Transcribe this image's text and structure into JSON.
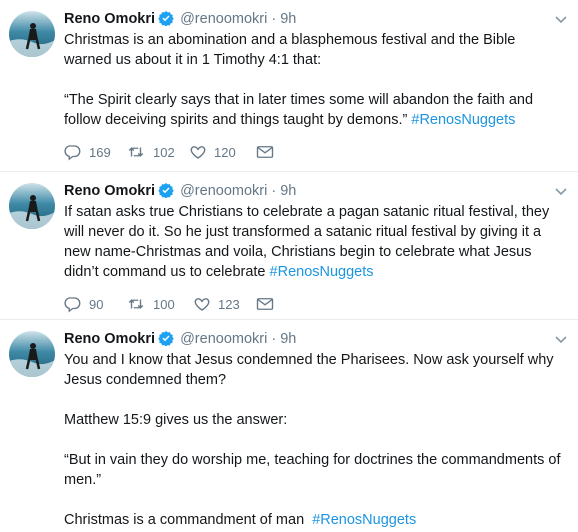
{
  "colors": {
    "text": "#14171a",
    "secondary": "#657786",
    "hashtag": "#1b95e0",
    "verified": "#1da1f2",
    "divider": "#e6ecf0"
  },
  "icons": {
    "reply": "reply-icon",
    "retweet": "retweet-icon",
    "like": "like-icon",
    "message": "message-icon",
    "verified": "verified-badge-icon",
    "menu": "chevron-down-icon"
  },
  "tweets": [
    {
      "name": "Reno Omokri",
      "handle": "@renoomokri",
      "dot": "·",
      "time": "9h",
      "para1": "Christmas is an abomination and a blasphemous festival and the Bible warned us about it in 1 Timothy 4:1 that:",
      "para2": "“The Spirit clearly says that in later times some will abandon the faith and follow deceiving spirits and things taught by demons.”",
      "hashtag": "#RenosNuggets",
      "replies": "169",
      "retweets": "102",
      "likes": "120"
    },
    {
      "name": "Reno Omokri",
      "handle": "@renoomokri",
      "dot": "·",
      "time": "9h",
      "para1": "If satan asks true Christians to celebrate a pagan satanic ritual festival, they will never do it. So he just transformed a satanic ritual festival by giving it a new name-Christmas and voila, Christians begin to celebrate what Jesus didn’t command us to celebrate",
      "hashtag": "#RenosNuggets",
      "replies": "90",
      "retweets": "100",
      "likes": "123"
    },
    {
      "name": "Reno Omokri",
      "handle": "@renoomokri",
      "dot": "·",
      "time": "9h",
      "para1": "You and I know that Jesus condemned the Pharisees. Now ask yourself why Jesus condemned them?",
      "para2": "Matthew 15:9 gives us the answer:",
      "para3": "“But in vain they do worship me, teaching for doctrines the commandments of men.”",
      "para4": "Christmas is a commandment of man",
      "hashtag": "#RenosNuggets"
    }
  ]
}
